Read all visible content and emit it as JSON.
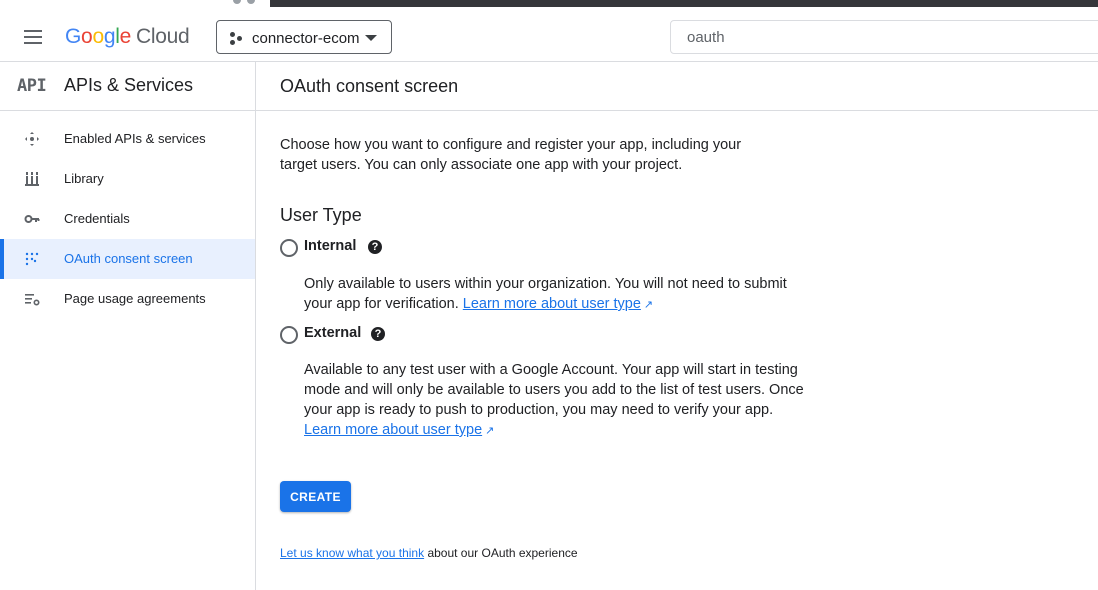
{
  "header": {
    "logo_google": "Google",
    "logo_cloud": "Cloud",
    "project_name": "connector-ecom",
    "search_value": "oauth"
  },
  "sidebar": {
    "icon_text": "API",
    "title": "APIs & Services",
    "items": [
      {
        "label": "Enabled APIs & services",
        "icon": "hub-icon",
        "active": false
      },
      {
        "label": "Library",
        "icon": "library-icon",
        "active": false
      },
      {
        "label": "Credentials",
        "icon": "key-icon",
        "active": false
      },
      {
        "label": "OAuth consent screen",
        "icon": "oauth-dots-icon",
        "active": true
      },
      {
        "label": "Page usage agreements",
        "icon": "settings-list-icon",
        "active": false
      }
    ]
  },
  "main": {
    "title": "OAuth consent screen",
    "intro": "Choose how you want to configure and register your app, including your target users. You can only associate one app with your project.",
    "section_title": "User Type",
    "options": [
      {
        "label": "Internal",
        "description": "Only available to users within your organization. You will not need to submit your app for verification.",
        "link": "Learn more about user type"
      },
      {
        "label": "External",
        "description": "Available to any test user with a Google Account. Your app will start in testing mode and will only be available to users you add to the list of test users. Once your app is ready to push to production, you may need to verify your app.",
        "link": "Learn more about user type"
      }
    ],
    "create_label": "CREATE",
    "feedback_link": "Let us know what you think",
    "feedback_text": "about our OAuth experience"
  },
  "colors": {
    "accent": "#1a73e8",
    "active_bg": "#e8f0fe",
    "divider": "#dadce0"
  }
}
